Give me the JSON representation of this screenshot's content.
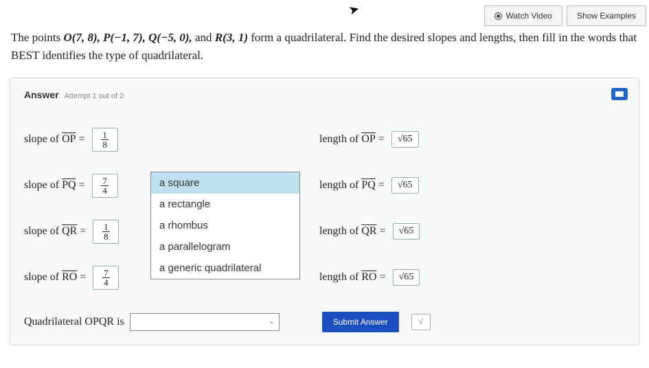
{
  "buttons": {
    "watch": "Watch Video",
    "examples": "Show Examples",
    "submit": "Submit Answer"
  },
  "problem": {
    "pre": "The points ",
    "pts": "O(7, 8), P(−1, 7), Q(−5, 0),",
    "mid": " and ",
    "pt_last": "R(3, 1)",
    "post": " form a quadrilateral. Find the desired slopes and lengths, then fill in the words that BEST identifies the type of quadrilateral."
  },
  "answer_label": "Answer",
  "attempt": "Attempt 1 out of 2",
  "rows": [
    {
      "slope_label": "slope of ",
      "seg": "OP",
      "eq": " =",
      "frac_n": "1",
      "frac_d": "8",
      "len_label": "length of ",
      "len_val": "√65"
    },
    {
      "slope_label": "slope of ",
      "seg": "PQ",
      "eq": " =",
      "frac_n": "7",
      "frac_d": "4",
      "len_label": "length of ",
      "len_val": "√65"
    },
    {
      "slope_label": "slope of ",
      "seg": "QR",
      "eq": " =",
      "frac_n": "1",
      "frac_d": "8",
      "len_label": "length of ",
      "len_val": "√65"
    },
    {
      "slope_label": "slope of ",
      "seg": "RO",
      "eq": " =",
      "frac_n": "7",
      "frac_d": "4",
      "len_label": "length of ",
      "len_val": "√65"
    }
  ],
  "dropdown": {
    "options": [
      "a square",
      "a rectangle",
      "a rhombus",
      "a parallelogram",
      "a generic quadrilateral"
    ],
    "highlighted": 0
  },
  "quad_text": "Quadrilateral OPQR is",
  "check_glyph": "√"
}
